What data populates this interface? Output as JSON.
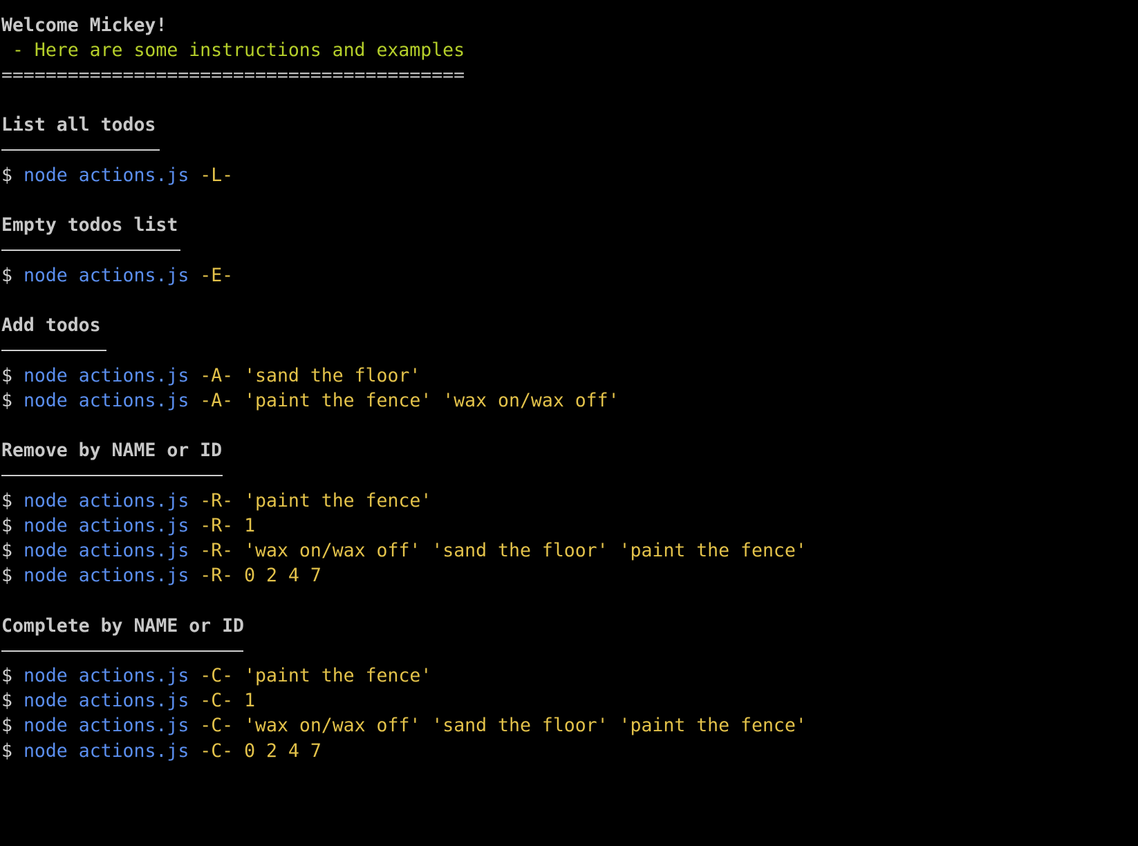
{
  "header": {
    "welcome": "Welcome Mickey!",
    "subtitle": " - Here are some instructions and examples",
    "rule": "=========================================="
  },
  "colors": {
    "background": "#000000",
    "heading": "#c8c8c8",
    "subtitle": "#b5cf2a",
    "command": "#5b8ff0",
    "argument": "#e3c24a"
  },
  "prompt": "$",
  "command": "node",
  "script": "actions.js",
  "sections": [
    {
      "title": "List all todos",
      "commands": [
        {
          "flag": "-L-",
          "args": ""
        }
      ]
    },
    {
      "title": "Empty todos list",
      "commands": [
        {
          "flag": "-E-",
          "args": ""
        }
      ]
    },
    {
      "title": "Add todos",
      "commands": [
        {
          "flag": "-A-",
          "args": "'sand the floor'"
        },
        {
          "flag": "-A-",
          "args": "'paint the fence' 'wax on/wax off'"
        }
      ]
    },
    {
      "title": "Remove by NAME or ID",
      "commands": [
        {
          "flag": "-R-",
          "args": "'paint the fence'"
        },
        {
          "flag": "-R-",
          "args": "1"
        },
        {
          "flag": "-R-",
          "args": "'wax on/wax off' 'sand the floor' 'paint the fence'"
        },
        {
          "flag": "-R-",
          "args": "0 2 4 7"
        }
      ]
    },
    {
      "title": "Complete by NAME or ID",
      "commands": [
        {
          "flag": "-C-",
          "args": "'paint the fence'"
        },
        {
          "flag": "-C-",
          "args": "1"
        },
        {
          "flag": "-C-",
          "args": "'wax on/wax off' 'sand the floor' 'paint the fence'"
        },
        {
          "flag": "-C-",
          "args": "0 2 4 7"
        }
      ]
    }
  ]
}
